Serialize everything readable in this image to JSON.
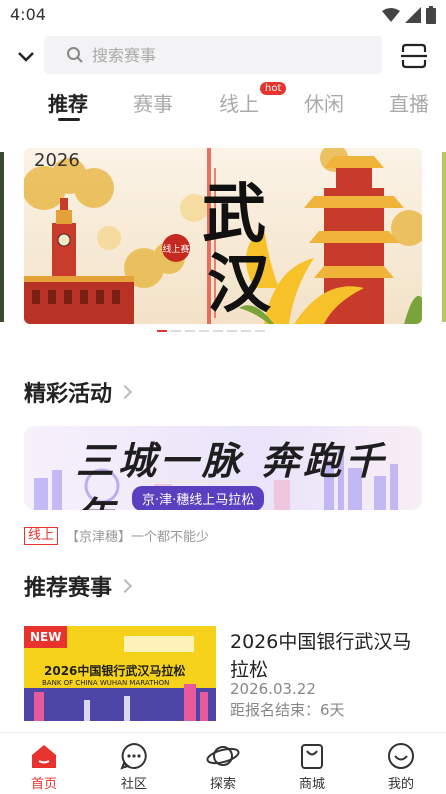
{
  "status": {
    "time": "4:04"
  },
  "search": {
    "placeholder": "搜索赛事"
  },
  "tabs": [
    {
      "label": "推荐"
    },
    {
      "label": "赛事"
    },
    {
      "label": "线上",
      "badge": "hot"
    },
    {
      "label": "休闲"
    },
    {
      "label": "直播"
    }
  ],
  "banner": {
    "year": "2026",
    "badge": "线上赛",
    "title": "武汉",
    "slide_index": 1,
    "slide_count": 8
  },
  "activities": {
    "title": "精彩活动",
    "banner_title": "三城一脉 奔跑千年",
    "banner_subtitle": "京·津·穗线上马拉松",
    "tag": "线上",
    "desc": "【京津穗】一个都不能少"
  },
  "races": {
    "title": "推荐赛事",
    "items": [
      {
        "image_badge": "NEW",
        "image_title": "2026中国银行武汉马拉松",
        "image_subtitle": "BANK OF CHINA WUHAN MARATHON",
        "name": "2026中国银行武汉马拉松",
        "date": "2026.03.22",
        "countdown": "距报名结束：6天"
      }
    ]
  },
  "nav": [
    {
      "label": "首页",
      "icon": "home-icon",
      "active": true
    },
    {
      "label": "社区",
      "icon": "chat-icon"
    },
    {
      "label": "探索",
      "icon": "planet-icon"
    },
    {
      "label": "商城",
      "icon": "shopping-bag-icon"
    },
    {
      "label": "我的",
      "icon": "smile-icon"
    }
  ],
  "colors": {
    "accent": "#e8322e"
  }
}
